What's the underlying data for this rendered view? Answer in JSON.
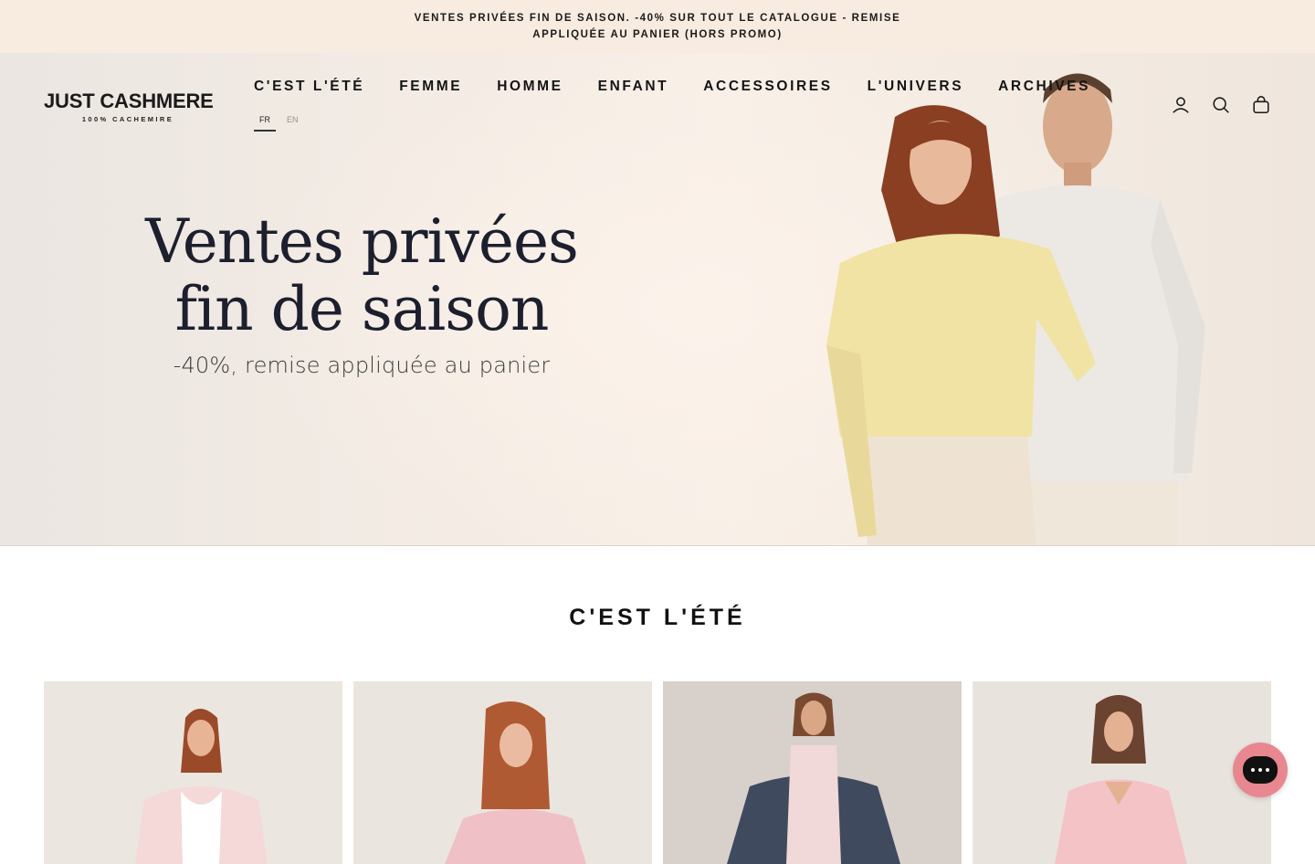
{
  "announcement": {
    "text": "VENTES PRIVÉES FIN DE SAISON. -40% SUR TOUT LE CATALOGUE - REMISE APPLIQUÉE AU PANIER (HORS PROMO)"
  },
  "brand": {
    "name": "JUST CASHMERE",
    "tagline": "100% CACHEMIRE"
  },
  "nav": {
    "items": [
      {
        "label": "C'EST L'ÉTÉ"
      },
      {
        "label": "FEMME"
      },
      {
        "label": "HOMME"
      },
      {
        "label": "ENFANT"
      },
      {
        "label": "ACCESSOIRES"
      },
      {
        "label": "L'UNIVERS"
      },
      {
        "label": "ARCHIVES"
      }
    ]
  },
  "language": {
    "active": "FR",
    "other": "EN"
  },
  "header_icons": [
    "account-icon",
    "search-icon",
    "cart-icon"
  ],
  "hero": {
    "title_line1": "Ventes privées",
    "title_line2": "fin de saison",
    "subtitle": "-40%, remise appliquée au panier"
  },
  "section": {
    "title": "C'EST L'ÉTÉ"
  },
  "colors": {
    "announcement_bg": "#f8ece1",
    "chat_button": "#e8878f",
    "text_dark": "#1c1f2e"
  },
  "chat": {
    "icon": "chat-bubble-icon"
  }
}
